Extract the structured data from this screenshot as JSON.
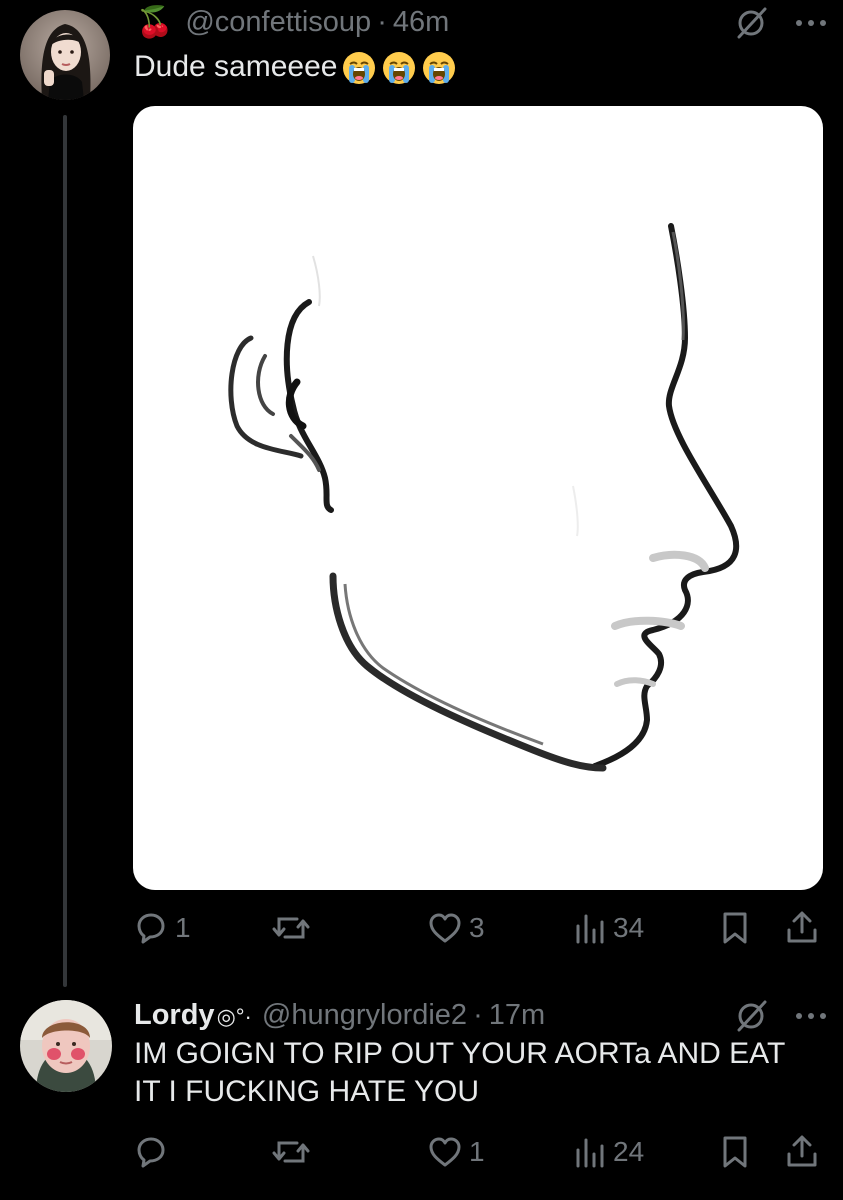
{
  "posts": [
    {
      "display_name": "",
      "name_prefix_emoji": "🍒",
      "handle": "@confettisoup",
      "separator": "·",
      "time": "46m",
      "text": "Dude sameeee",
      "trailing_emoji_count": 3,
      "trailing_emoji": "loudly-crying-face",
      "has_media": true,
      "media_description_icon": "face-profile-line-drawing",
      "actions": {
        "replies": "1",
        "reposts": "",
        "likes": "3",
        "views": "34"
      }
    },
    {
      "display_name": "Lordy",
      "name_suffix": "◎°·",
      "handle": "@hungrylordie2",
      "separator": "·",
      "time": "17m",
      "text": "IM GOIGN TO RIP OUT YOUR AORTa AND EAT IT I FUCKING HATE YOU",
      "has_media": false,
      "actions": {
        "replies": "",
        "reposts": "",
        "likes": "1",
        "views": "24"
      }
    }
  ],
  "colors": {
    "background": "#000000",
    "text_primary": "#e7e9ea",
    "text_secondary": "#71767b",
    "thread_line": "#333639"
  },
  "icons": {
    "grok": "grok-icon",
    "more": "more-icon",
    "reply": "reply-icon",
    "repost": "repost-icon",
    "like": "heart-icon",
    "views": "views-icon",
    "bookmark": "bookmark-icon",
    "share": "share-icon"
  }
}
